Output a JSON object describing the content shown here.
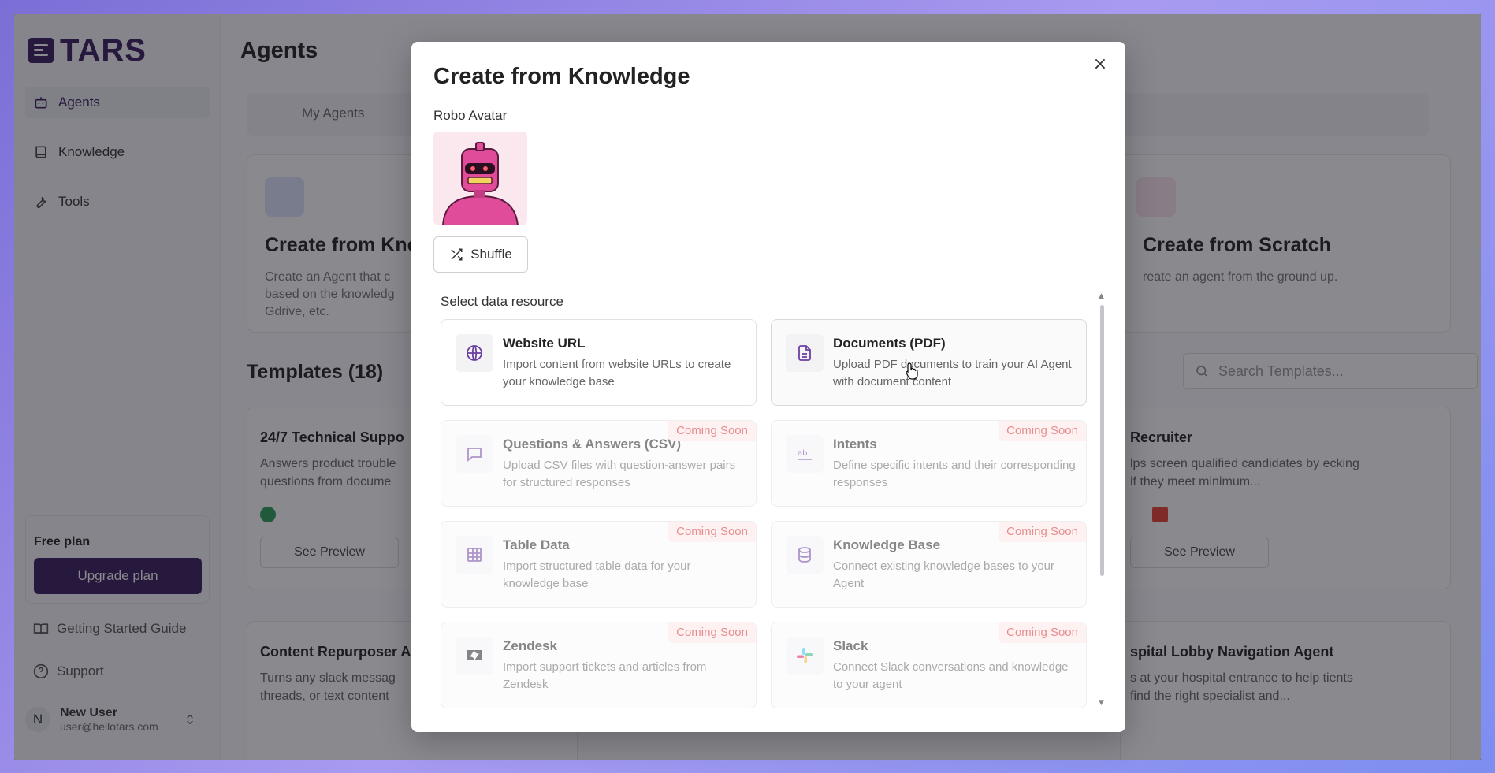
{
  "app": {
    "logo_text": "TARS",
    "brand_color": "#3a1d5c"
  },
  "sidebar": {
    "items": [
      {
        "label": "Agents",
        "icon": "robot-icon",
        "active": true
      },
      {
        "label": "Knowledge",
        "icon": "book-icon"
      },
      {
        "label": "Tools",
        "icon": "wrench-icon"
      }
    ],
    "plan": {
      "title": "Free plan",
      "button": "Upgrade plan"
    },
    "links": [
      {
        "label": "Getting Started Guide",
        "icon": "book-open-icon"
      },
      {
        "label": "Support",
        "icon": "help-circle-icon"
      }
    ],
    "user": {
      "initial": "N",
      "name": "New User",
      "email": "user@hellotars.com"
    }
  },
  "main": {
    "title": "Agents",
    "tabs": [
      {
        "label": "My Agents"
      }
    ],
    "create_cards": [
      {
        "title": "Create from Kno",
        "desc": "Create an Agent that c based on the knowledg Gdrive, etc."
      },
      {
        "title": "Create from Scratch",
        "desc": "reate an agent from the ground up."
      }
    ],
    "templates_heading": "Templates (18)",
    "search_placeholder": "Search Templates...",
    "templates": [
      {
        "title": "24/7 Technical Suppo",
        "desc": "Answers product trouble questions from docume",
        "button": "See Preview"
      },
      {
        "title": "Recruiter",
        "desc": "lps screen qualified candidates by ecking if they meet minimum...",
        "button": "See Preview"
      },
      {
        "title": "Content Repurposer A",
        "desc": "Turns any slack messag threads, or text content"
      },
      {
        "title": "spital Lobby Navigation Agent",
        "desc": "s at your hospital entrance to help tients find the right specialist and..."
      }
    ]
  },
  "modal": {
    "title": "Create from Knowledge",
    "close_label": "×",
    "avatar_label": "Robo Avatar",
    "shuffle_label": "Shuffle",
    "section_label": "Select data resource",
    "coming_soon_label": "Coming Soon",
    "resources": [
      {
        "title": "Website URL",
        "desc": "Import content from website URLs to create your knowledge base",
        "icon": "globe-icon",
        "coming_soon": false
      },
      {
        "title": "Documents (PDF)",
        "desc": "Upload PDF documents to train your AI Agent with document content",
        "icon": "document-icon",
        "coming_soon": false
      },
      {
        "title": "Questions & Answers (CSV)",
        "desc": "Upload CSV files with question-answer pairs for structured responses",
        "icon": "chat-icon",
        "coming_soon": true
      },
      {
        "title": "Intents",
        "desc": "Define specific intents and their corresponding responses",
        "icon": "intents-icon",
        "coming_soon": true
      },
      {
        "title": "Table Data",
        "desc": "Import structured table data for your knowledge base",
        "icon": "table-icon",
        "coming_soon": true
      },
      {
        "title": "Knowledge Base",
        "desc": "Connect existing knowledge bases to your Agent",
        "icon": "database-icon",
        "coming_soon": true
      },
      {
        "title": "Zendesk",
        "desc": "Import support tickets and articles from Zendesk",
        "icon": "zendesk-icon",
        "coming_soon": true
      },
      {
        "title": "Slack",
        "desc": "Connect Slack conversations and knowledge to your agent",
        "icon": "slack-icon",
        "coming_soon": true
      }
    ]
  }
}
